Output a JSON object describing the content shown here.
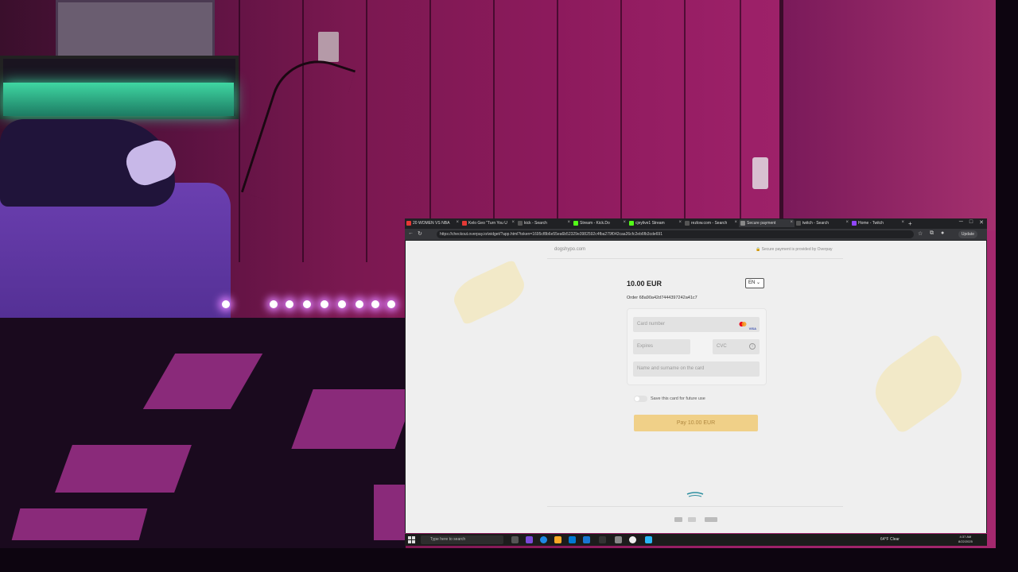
{
  "browser": {
    "tabs": [
      {
        "label": "20 WOMEN VS NBA",
        "color": "#e53935"
      },
      {
        "label": "Kelo Geo \"Turn You U",
        "color": "#e53935"
      },
      {
        "label": "kick - Search",
        "color": "#555555"
      },
      {
        "label": "Stream - Kick.Do",
        "color": "#53fc18"
      },
      {
        "label": "cjeylive1 Stream",
        "color": "#53fc18"
      },
      {
        "label": "rezlow.com - Search",
        "color": "#555555"
      },
      {
        "label": "Secure payment",
        "color": "#888888"
      },
      {
        "label": "twitch - Search",
        "color": "#555555"
      },
      {
        "label": "Home - Twitch",
        "color": "#9146ff"
      }
    ],
    "active_tab_index": 6,
    "url": "https://checkout.overpay.io/widget/?app.html?token=1695cf8b6e55ea6b52329e3982592c4fba279f042caa26cfc2eb6fb3cde691",
    "update_label": "Update"
  },
  "checkout": {
    "site_name": "dogshypo.com",
    "secure_note": "Secure payment is provided by Overpay",
    "amount": "10.00 EUR",
    "language": "EN",
    "order": "Order 68a90a42d7444397242a41c7",
    "card_number_placeholder": "Card number",
    "visa_label": "VISA",
    "expires_placeholder": "Expires",
    "cvc_placeholder": "CVC",
    "name_placeholder": "Name and surname on the card",
    "save_card_label": "Save this card for future use",
    "pay_button": "Pay 10.00 EUR",
    "accent_color": "#f0d088"
  },
  "taskbar": {
    "search_placeholder": "Type here to search",
    "weather": "64°F  Clear",
    "time": "4:37 AM",
    "date": "8/22/2025"
  }
}
